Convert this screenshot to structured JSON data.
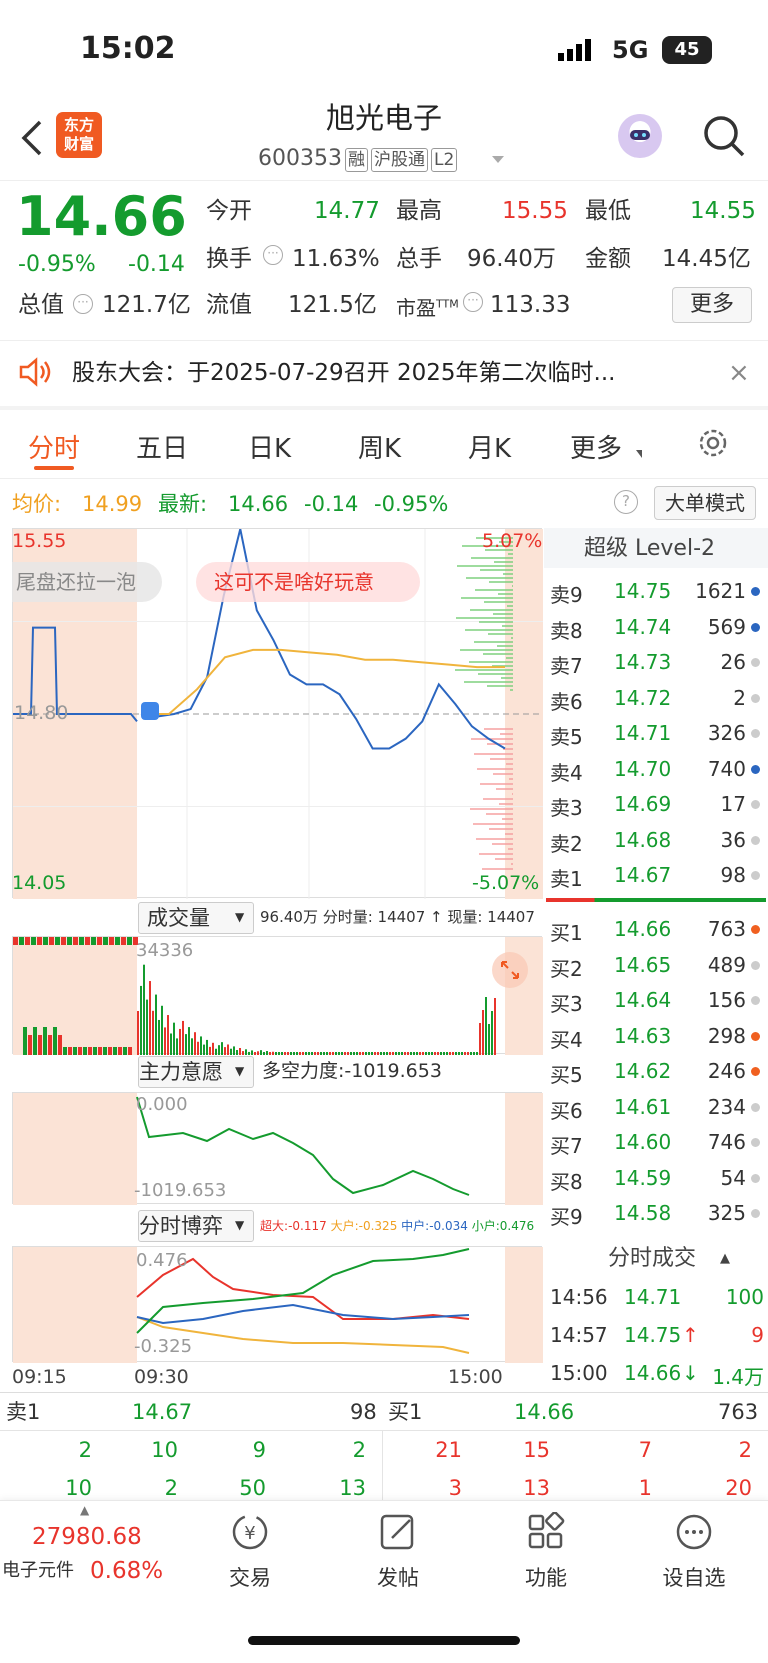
{
  "status_bar": {
    "time": "15:02",
    "network": "5G",
    "battery": "45"
  },
  "header": {
    "logo_line1": "东方",
    "logo_line2": "财富",
    "title": "旭光电子",
    "code": "600353",
    "badges": [
      "融",
      "沪股通",
      "L2"
    ]
  },
  "quote": {
    "price": "14.66",
    "change_pct": "-0.95%",
    "change": "-0.14",
    "open_label": "今开",
    "open": "14.77",
    "high_label": "最高",
    "high": "15.55",
    "low_label": "最低",
    "low": "14.55",
    "turnover_label": "换手",
    "turnover": "11.63%",
    "volume_label": "总手",
    "volume": "96.40万",
    "amount_label": "金额",
    "amount": "14.45亿",
    "mktcap_label": "总值",
    "mktcap": "121.7亿",
    "float_label": "流值",
    "float": "121.5亿",
    "pe_label": "市盈",
    "pe_sup": "TTM",
    "pe": "113.33",
    "more_button": "更多"
  },
  "notice": {
    "text": "股东大会：于2025-07-29召开 2025年第二次临时..."
  },
  "tabs": [
    "分时",
    "五日",
    "日K",
    "周K",
    "月K",
    "更多"
  ],
  "chart_info": {
    "avg_label": "均价:",
    "avg": "14.99",
    "last_label": "最新:",
    "last": "14.66",
    "chg": "-0.14",
    "pct": "-0.95%",
    "mode_button": "大单模式"
  },
  "chart_data": [
    {
      "type": "line",
      "title": "",
      "y_axis_left": [
        "15.55",
        "14.80",
        "14.05"
      ],
      "y_axis_right": [
        "5.07%",
        "-5.07%"
      ],
      "x": [
        "09:15",
        "09:30",
        "15:00"
      ],
      "ylim": [
        14.05,
        15.55
      ],
      "prev_close": 14.8,
      "series": [
        {
          "name": "最新",
          "values": [
            14.8,
            14.79,
            14.8,
            14.82,
            14.95,
            15.28,
            15.55,
            15.22,
            15.1,
            14.96,
            14.92,
            14.92,
            14.88,
            14.78,
            14.66,
            14.66,
            14.7,
            14.77,
            14.92,
            14.84,
            14.75,
            14.7,
            14.66
          ]
        },
        {
          "name": "均价",
          "values": [
            14.8,
            14.8,
            14.9,
            15.03,
            15.06,
            15.06,
            15.05,
            15.04,
            15.02,
            15.02,
            15.01,
            15.0,
            14.99,
            14.99
          ]
        }
      ],
      "annotations": [
        "尾盘还拉一泡",
        "这可不是啥好玩意"
      ]
    },
    {
      "type": "bar",
      "title": "成交量",
      "stats": "96.40万 分时量: 14407 ↑ 现量: 14407",
      "y_max_label": "34336"
    },
    {
      "type": "line",
      "title": "主力意愿",
      "stats": "多空力度:-1019.653",
      "y_labels": [
        "0.000",
        "-1019.653"
      ]
    },
    {
      "type": "line",
      "title": "分时博弈",
      "legend": [
        {
          "name": "超大",
          "value": "-0.117",
          "color": "#e8342c"
        },
        {
          "name": "大户",
          "value": "-0.325",
          "color": "#f0a020"
        },
        {
          "name": "中户",
          "value": "-0.034",
          "color": "#2b66c0"
        },
        {
          "name": "小户",
          "value": "0.476",
          "color": "#149b2e"
        }
      ],
      "y_labels": [
        "0.476",
        "-0.325"
      ]
    }
  ],
  "level2": {
    "title": "超级 Level-2",
    "asks": [
      {
        "l": "卖9",
        "p": "14.75",
        "v": "1621",
        "c": "#2b66c0"
      },
      {
        "l": "卖8",
        "p": "14.74",
        "v": "569",
        "c": "#2b66c0"
      },
      {
        "l": "卖7",
        "p": "14.73",
        "v": "26",
        "c": "#ccc"
      },
      {
        "l": "卖6",
        "p": "14.72",
        "v": "2",
        "c": "#ccc"
      },
      {
        "l": "卖5",
        "p": "14.71",
        "v": "326",
        "c": "#ccc"
      },
      {
        "l": "卖4",
        "p": "14.70",
        "v": "740",
        "c": "#2b66c0"
      },
      {
        "l": "卖3",
        "p": "14.69",
        "v": "17",
        "c": "#ccc"
      },
      {
        "l": "卖2",
        "p": "14.68",
        "v": "36",
        "c": "#ccc"
      },
      {
        "l": "卖1",
        "p": "14.67",
        "v": "98",
        "c": "#ccc"
      }
    ],
    "bids": [
      {
        "l": "买1",
        "p": "14.66",
        "v": "763",
        "c": "#f06020"
      },
      {
        "l": "买2",
        "p": "14.65",
        "v": "489",
        "c": "#ccc"
      },
      {
        "l": "买3",
        "p": "14.64",
        "v": "156",
        "c": "#ccc"
      },
      {
        "l": "买4",
        "p": "14.63",
        "v": "298",
        "c": "#f06020"
      },
      {
        "l": "买5",
        "p": "14.62",
        "v": "246",
        "c": "#f06020"
      },
      {
        "l": "买6",
        "p": "14.61",
        "v": "234",
        "c": "#ccc"
      },
      {
        "l": "买7",
        "p": "14.60",
        "v": "746",
        "c": "#ccc"
      },
      {
        "l": "买8",
        "p": "14.59",
        "v": "54",
        "c": "#ccc"
      },
      {
        "l": "买9",
        "p": "14.58",
        "v": "325",
        "c": "#ccc"
      }
    ],
    "trades_title": "分时成交",
    "trades": [
      {
        "t": "14:56",
        "p": "14.71",
        "a": "",
        "v": "100"
      },
      {
        "t": "14:57",
        "p": "14.75",
        "a": "↑",
        "v": "9"
      },
      {
        "t": "15:00",
        "p": "14.66",
        "a": "↓",
        "v": "1.4万"
      }
    ]
  },
  "queue": {
    "ask_label": "卖1",
    "ask_price": "14.67",
    "ask_vol": "98",
    "bid_label": "买1",
    "bid_price": "14.66",
    "bid_vol": "763",
    "ask_rows": [
      [
        "2",
        "10",
        "9",
        "2"
      ],
      [
        "10",
        "2",
        "50",
        "13"
      ]
    ],
    "bid_rows": [
      [
        "21",
        "15",
        "7",
        "2"
      ],
      [
        "3",
        "13",
        "1",
        "20"
      ]
    ]
  },
  "bottom": {
    "index_value": "27980.68",
    "index_name": "电子元件",
    "index_pct": "0.68%",
    "items": [
      "交易",
      "发帖",
      "功能",
      "设自选"
    ]
  }
}
